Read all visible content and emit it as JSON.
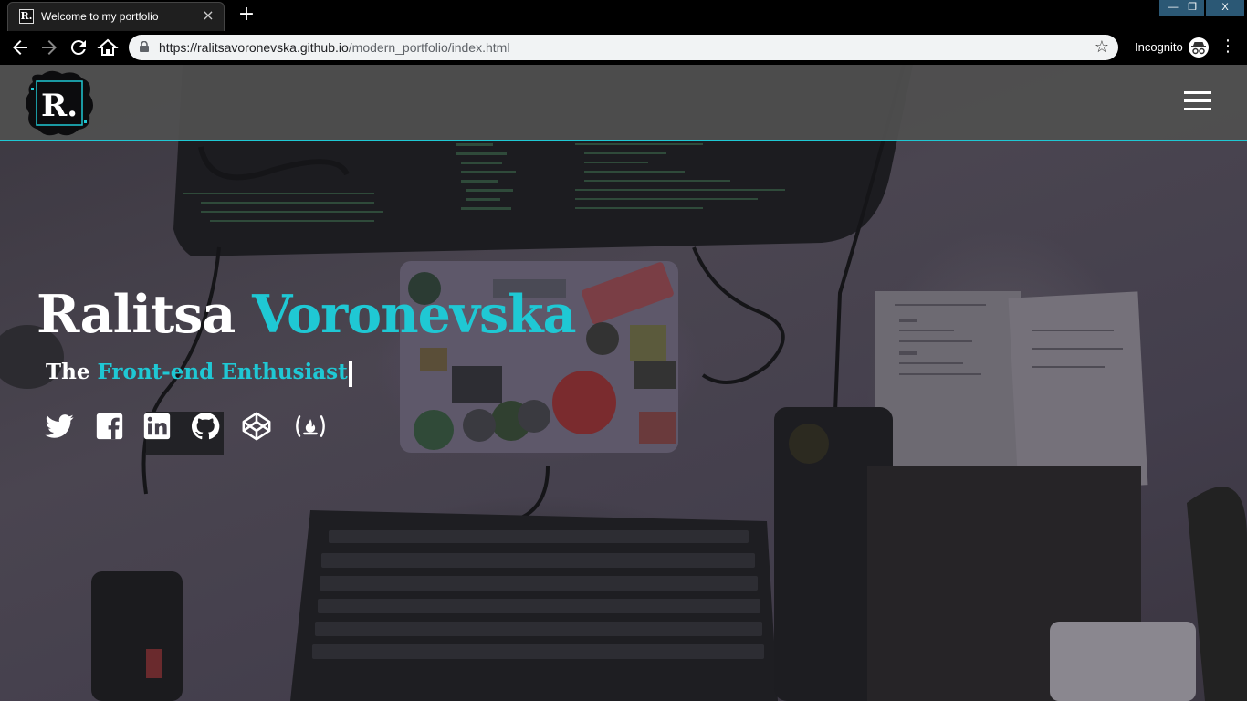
{
  "browser": {
    "tab_title": "Welcome to my portfolio",
    "tab_favicon": "R.",
    "close_tab": "×",
    "new_tab": "+",
    "window_min": "—",
    "window_max": "❐",
    "window_close": "X",
    "url_host": "https://ralitsavoronevska.github.io",
    "url_path": "/modern_portfolio/index.html",
    "incognito_label": "Incognito",
    "icons": [
      "back-arrow-icon",
      "forward-arrow-icon",
      "reload-icon",
      "home-icon",
      "lock-icon",
      "star-icon",
      "incognito-icon",
      "menu-dots-icon"
    ]
  },
  "site": {
    "logo_text": "R.",
    "hero": {
      "first_name": "Ralitsa",
      "last_name": "Voronevska",
      "subtitle_prefix": "The",
      "subtitle_highlight": "Front-end Enthusiast"
    },
    "social_icons": [
      "twitter-icon",
      "facebook-icon",
      "linkedin-icon",
      "github-icon",
      "codepen-icon",
      "freecodecamp-icon"
    ]
  },
  "colors": {
    "accent": "#1fc8d4",
    "navbar": "#505050",
    "text": "#ffffff"
  }
}
